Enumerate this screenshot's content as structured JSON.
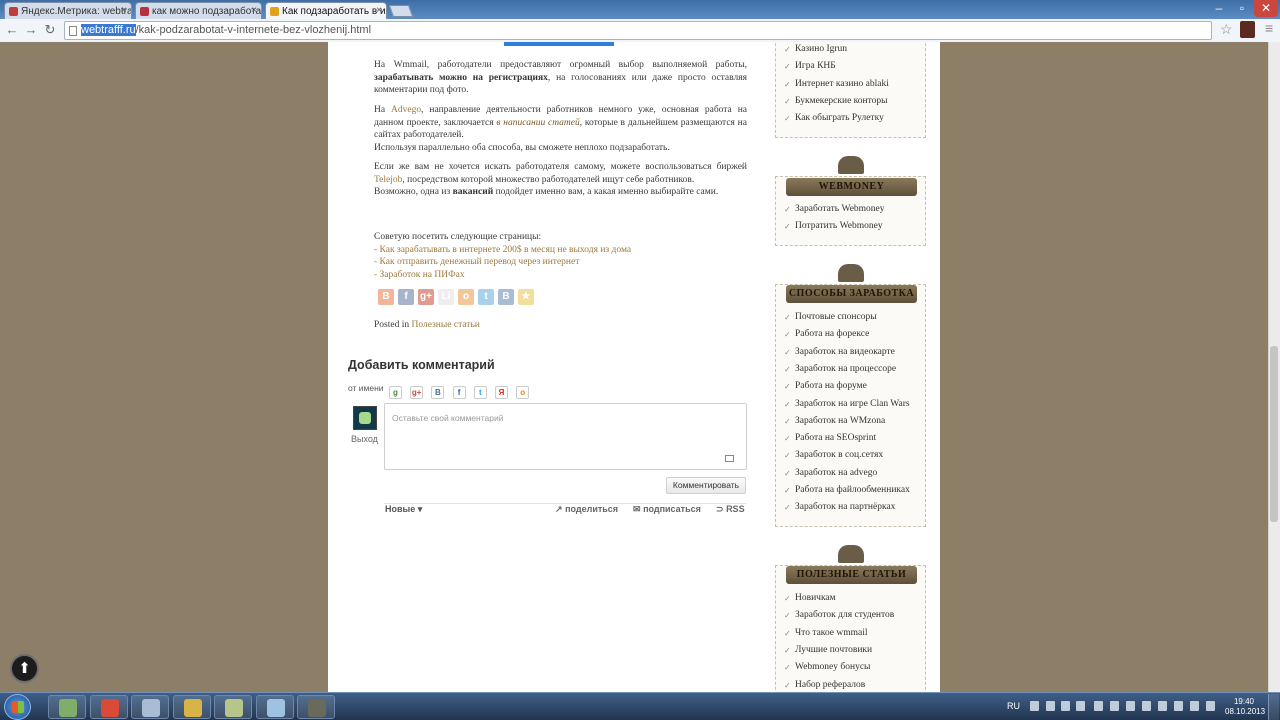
{
  "browser": {
    "tabs": [
      {
        "label": "Яндекс.Метрика: webtraff",
        "fav": "#c23b3b"
      },
      {
        "label": "как можно подзаработать",
        "fav": "#b8313c"
      },
      {
        "label": "Как подзаработать в инте",
        "fav": "#e3a01b"
      }
    ],
    "close_glyph": "×",
    "url_host": "webtrafff.ru",
    "url_path": "/kak-podzarabotat-v-internete-bez-vlozhenij.html"
  },
  "article": {
    "p1": [
      "На Wmmail, работодатели предоставляют огромный выбор выполняемой работы,",
      "зарабатывать можно на регистрациях",
      ", на голосованиях или даже просто оставляя комментарии под фото."
    ],
    "p2": [
      "На ",
      "Advego",
      ", направление деятельности работников немного уже, основная работа на данном проекте, заключается ",
      "в написании статей",
      ", которые в дальнейшем размещаются на сайтах работодателей."
    ],
    "p3": "Используя параллельно оба способа, вы сможете неплохо подзаработать.",
    "p4": [
      "Если же вам не хочется искать работодателя самому, можете воспользоваться биржей ",
      "Telejob",
      ", посредством которой множество работодателей ищут себе работников."
    ],
    "p5": [
      "Возможно, одна из ",
      "вакансий",
      " подойдет именно вам, а какая именно выбирайте сами."
    ],
    "recommend": "Советую посетить следующие страницы:",
    "links": [
      "- Как зарабатывать в интернете 200$ в месяц не выходя из дома",
      "- Как отправить денежный перевод через интернет",
      "- Заработок на ПИФах"
    ],
    "share_icons": [
      {
        "name": "blogger-icon",
        "c": "#f3b59a",
        "g": "B"
      },
      {
        "name": "facebook-icon",
        "c": "#a7b4cc",
        "g": "f"
      },
      {
        "name": "google-plus-icon",
        "c": "#e09a90",
        "g": "g+"
      },
      {
        "name": "liveinternet-icon",
        "c": "#eeeeee",
        "g": "Li"
      },
      {
        "name": "odnoklassniki-icon",
        "c": "#f4c79b",
        "g": "о"
      },
      {
        "name": "twitter-icon",
        "c": "#a9d2ea",
        "g": "t"
      },
      {
        "name": "vkontakte-icon",
        "c": "#a9bcd3",
        "g": "В"
      },
      {
        "name": "star-icon",
        "c": "#f3de9a",
        "g": "★"
      }
    ],
    "posted_in": "Posted in",
    "category": "Полезные статьи"
  },
  "comments": {
    "heading": "Добавить комментарий",
    "from": "от имени",
    "social": [
      {
        "name": "google-icon",
        "c": "#4a8a3a",
        "g": "g"
      },
      {
        "name": "google-plus-icon",
        "c": "#d14836",
        "g": "g+"
      },
      {
        "name": "vkontakte-icon",
        "c": "#4a6a94",
        "g": "B"
      },
      {
        "name": "facebook-icon",
        "c": "#3b5998",
        "g": "f"
      },
      {
        "name": "twitter-icon",
        "c": "#2aa3ef",
        "g": "t"
      },
      {
        "name": "yandex-icon",
        "c": "#e0261a",
        "g": "Я"
      },
      {
        "name": "odnoklassniki-icon",
        "c": "#ee8208",
        "g": "о"
      }
    ],
    "logout": "Выход",
    "placeholder": "Оставьте свой комментарий",
    "submit": "Комментировать",
    "sort": "Новые",
    "share": "поделиться",
    "subscribe": "подписаться",
    "rss": "RSS"
  },
  "sidebar": {
    "casino_items": [
      "Казино Igrun",
      "Игра КНБ",
      "Интернет казино ablaki",
      "Букмекерские конторы",
      "Как обыграть Рулетку"
    ],
    "webmoney": {
      "title": "WEBMONEY",
      "items": [
        "Заработать Webmoney",
        "Потратить Webmoney"
      ]
    },
    "ways": {
      "title": "СПОСОБЫ ЗАРАБОТКА",
      "items": [
        "Почтовые спонсоры",
        "Работа на форексе",
        "Заработок на видеокарте",
        "Заработок на процессоре",
        "Работа на форуме",
        "Заработок на игре Clan Wars",
        "Заработок на WMzona",
        "Работа на SEOsprint",
        "Заработок в соц.сетях",
        "Заработок на advego",
        "Работа на файлообменниках",
        "Заработок на партнёрках"
      ]
    },
    "useful": {
      "title": "ПОЛЕЗНЫЕ СТАТЬИ",
      "items": [
        "Новичкам",
        "Заработок для студентов",
        "Что такое wmmail",
        "Лучшие почтовики",
        "Webmoney бонусы",
        "Набор рефералов"
      ]
    },
    "check": "✓"
  },
  "taskbar": {
    "apps": [
      {
        "name": "network-app-icon",
        "c": "#7fae6a"
      },
      {
        "name": "chrome-icon",
        "c": "#d94a38"
      },
      {
        "name": "calculator-icon",
        "c": "#a9bcd6"
      },
      {
        "name": "star-app-icon",
        "c": "#d8b347"
      },
      {
        "name": "document-app-icon",
        "c": "#b7c48a"
      },
      {
        "name": "notepad-icon",
        "c": "#9ec3e0"
      },
      {
        "name": "game-app-icon",
        "c": "#6a6a5a"
      }
    ],
    "lang": "RU",
    "time": "19:40",
    "date": "08.10.2013"
  }
}
